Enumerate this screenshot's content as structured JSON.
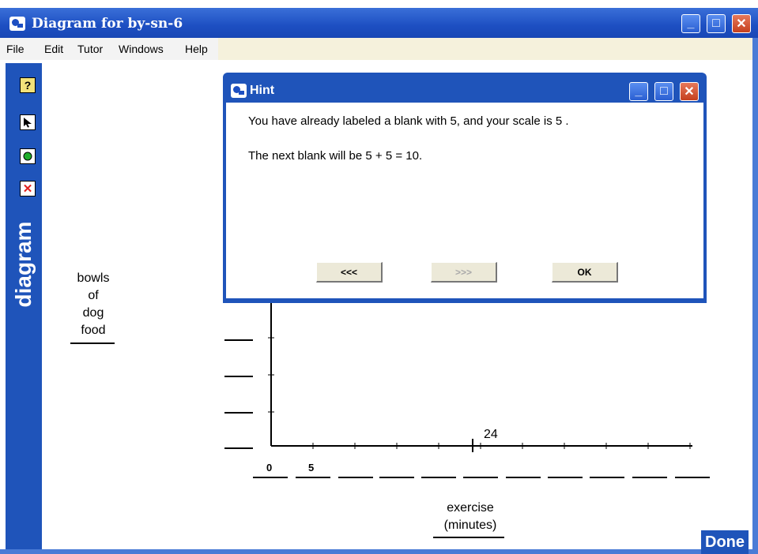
{
  "window": {
    "title": "Diagram for by-sn-6"
  },
  "menu": [
    "File",
    "Edit",
    "Tutor",
    "Windows",
    "Help"
  ],
  "sidebar": {
    "label": "diagram",
    "tools": [
      "hint-tool",
      "pointer-tool",
      "point-tool",
      "delete-tool"
    ]
  },
  "diagram": {
    "y_axis_label": [
      "bowls",
      "of",
      "dog",
      "food"
    ],
    "x_axis_label": [
      "exercise",
      "(minutes)"
    ],
    "x_blank_values": [
      "0",
      "5",
      "",
      "",
      "",
      "",
      "",
      "",
      "",
      "",
      "",
      ""
    ],
    "marked_point_label": "24"
  },
  "hint": {
    "title": "Hint",
    "line1": "You have already labeled a blank with 5, and your scale is 5 .",
    "line2": "The next blank will be 5 + 5 = 10.",
    "prev_label": "<<<",
    "next_label": ">>>",
    "ok_label": "OK"
  },
  "done_label": "Done"
}
